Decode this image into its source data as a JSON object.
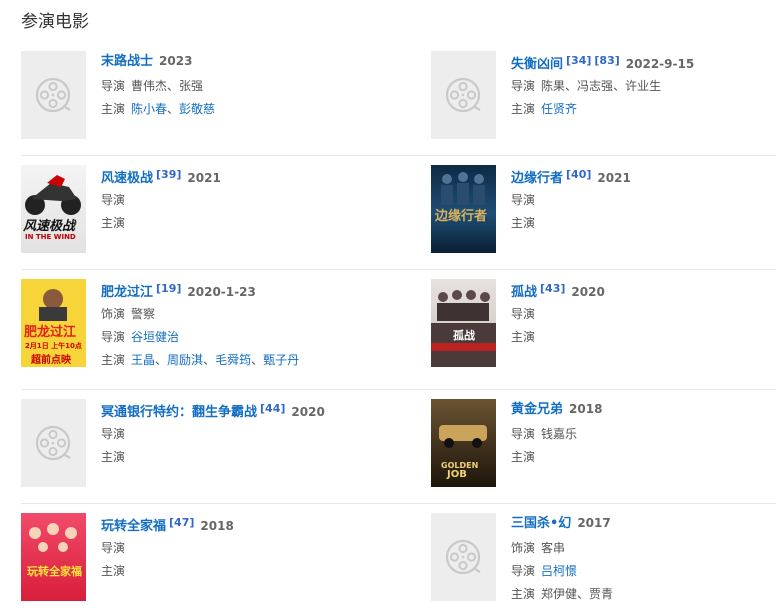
{
  "section_title": "参演电影",
  "movies": [
    {
      "title": "末路战士",
      "refs": [],
      "year": "2023",
      "poster": "placeholder",
      "lines": [
        {
          "label": "导演",
          "names": [
            "曹伟杰",
            "张强"
          ],
          "link": false
        },
        {
          "label": "主演",
          "names": [
            "陈小春",
            "彭敬慈"
          ],
          "link": true
        }
      ]
    },
    {
      "title": "失衡凶间",
      "refs": [
        "[34]",
        "[83]"
      ],
      "year": "2022-9-15",
      "poster": "placeholder",
      "lines": [
        {
          "label": "导演",
          "names": [
            "陈果",
            "冯志强",
            "许业生"
          ],
          "link": false
        },
        {
          "label": "主演",
          "names": [
            "任贤齐"
          ],
          "link": true
        }
      ]
    },
    {
      "title": "风速极战",
      "refs": [
        "[39]"
      ],
      "year": "2021",
      "poster": "motorbike",
      "poster_text": [
        "风速极战",
        "IN THE WIND"
      ],
      "lines": [
        {
          "label": "导演",
          "names": [],
          "link": false
        },
        {
          "label": "主演",
          "names": [],
          "link": false
        }
      ]
    },
    {
      "title": "边缘行者",
      "refs": [
        "[40]"
      ],
      "year": "2021",
      "poster": "blue",
      "poster_text": [
        "边缘行者"
      ],
      "lines": [
        {
          "label": "导演",
          "names": [],
          "link": false
        },
        {
          "label": "主演",
          "names": [],
          "link": false
        }
      ]
    },
    {
      "title": "肥龙过江",
      "refs": [
        "[19]"
      ],
      "year": "2020-1-23",
      "poster": "yellow",
      "poster_text": [
        "肥龙过江",
        "2月1日 上午10点",
        "超前点映"
      ],
      "lines": [
        {
          "label": "饰演",
          "names": [
            "警察"
          ],
          "link": false
        },
        {
          "label": "导演",
          "names": [
            "谷垣健治"
          ],
          "link": true
        },
        {
          "label": "主演",
          "names": [
            "王晶",
            "周励淇",
            "毛舜筠",
            "甄子丹"
          ],
          "link": true
        }
      ]
    },
    {
      "title": "孤战",
      "refs": [
        "[43]"
      ],
      "year": "2020",
      "poster": "grey",
      "poster_text": [
        "孤战"
      ],
      "lines": [
        {
          "label": "导演",
          "names": [],
          "link": false
        },
        {
          "label": "主演",
          "names": [],
          "link": false
        }
      ]
    },
    {
      "title": "冥通银行特约：翻生争霸战",
      "refs": [
        "[44]"
      ],
      "year": "2020",
      "poster": "placeholder",
      "lines": [
        {
          "label": "导演",
          "names": [],
          "link": false
        },
        {
          "label": "主演",
          "names": [],
          "link": false
        }
      ]
    },
    {
      "title": "黄金兄弟",
      "refs": [],
      "year": "2018",
      "poster": "golden",
      "poster_text": [
        "GOLDEN",
        "JOB"
      ],
      "lines": [
        {
          "label": "导演",
          "names": [
            "钱嘉乐"
          ],
          "link": false
        },
        {
          "label": "主演",
          "names": [],
          "link": false
        }
      ]
    },
    {
      "title": "玩转全家福",
      "refs": [
        "[47]"
      ],
      "year": "2018",
      "poster": "red",
      "poster_text": [
        "玩转全家福"
      ],
      "lines": [
        {
          "label": "导演",
          "names": [],
          "link": false
        },
        {
          "label": "主演",
          "names": [],
          "link": false
        }
      ]
    },
    {
      "title": "三国杀•幻",
      "refs": [],
      "year": "2017",
      "poster": "placeholder",
      "lines": [
        {
          "label": "饰演",
          "names": [
            "客串"
          ],
          "link": false
        },
        {
          "label": "导演",
          "names": [
            "吕柯憬"
          ],
          "link": true
        },
        {
          "label": "主演",
          "names": [
            "郑伊健",
            "贾青"
          ],
          "link": false
        }
      ]
    }
  ]
}
